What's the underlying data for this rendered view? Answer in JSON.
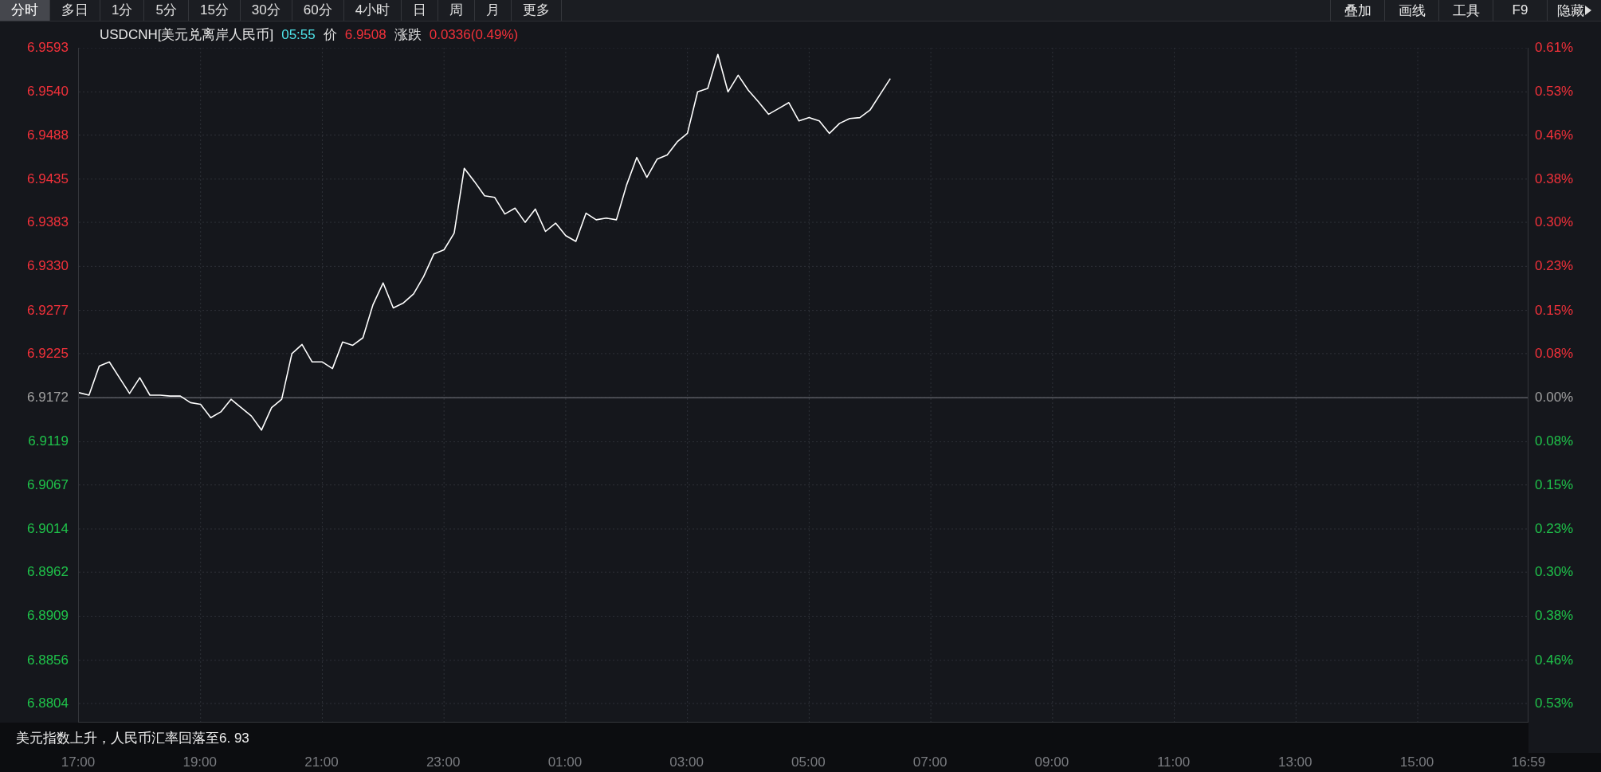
{
  "toolbar": {
    "tabs": [
      {
        "label": "分时",
        "selected": true
      },
      {
        "label": "多日",
        "selected": false
      },
      {
        "label": "1分",
        "selected": false
      },
      {
        "label": "5分",
        "selected": false
      },
      {
        "label": "15分",
        "selected": false
      },
      {
        "label": "30分",
        "selected": false
      },
      {
        "label": "60分",
        "selected": false
      },
      {
        "label": "4小时",
        "selected": false
      },
      {
        "label": "日",
        "selected": false
      },
      {
        "label": "周",
        "selected": false
      },
      {
        "label": "月",
        "selected": false
      },
      {
        "label": "更多",
        "selected": false
      }
    ],
    "tools": [
      {
        "label": "叠加",
        "kind": "button"
      },
      {
        "label": "画线",
        "kind": "button"
      },
      {
        "label": "工具",
        "kind": "button"
      },
      {
        "label": "F9",
        "kind": "button"
      },
      {
        "label": "隐藏",
        "kind": "expander"
      }
    ]
  },
  "quote": {
    "symbol": "USDCNH[美元兑离岸人民币]",
    "time": "05:55",
    "price_label": "价",
    "price": "6.9508",
    "change_label": "涨跌",
    "change": "0.0336(0.49%)"
  },
  "chart": {
    "percent_labels": [
      "0.61%",
      "0.53%",
      "0.46%",
      "0.38%",
      "0.30%",
      "0.23%",
      "0.15%",
      "0.08%",
      "0.00%",
      "0.08%",
      "0.15%",
      "0.23%",
      "0.30%",
      "0.38%",
      "0.46%",
      "0.53%"
    ],
    "chart_data": {
      "type": "line",
      "grid": true,
      "ylim": [
        6.8781,
        6.9593
      ],
      "categories": [
        "17:00",
        null,
        null,
        null,
        null,
        null,
        null,
        null,
        null,
        null,
        null,
        null,
        "19:00",
        null,
        null,
        null,
        null,
        null,
        null,
        null,
        null,
        null,
        null,
        null,
        "21:00",
        null,
        null,
        null,
        null,
        null,
        null,
        null,
        null,
        null,
        null,
        null,
        "23:00",
        null,
        null,
        null,
        null,
        null,
        null,
        null,
        null,
        null,
        null,
        null,
        "01:00",
        null,
        null,
        null,
        null,
        null,
        null,
        null,
        null,
        null,
        null,
        null,
        "03:00",
        null,
        null,
        null,
        null,
        null,
        null,
        null,
        null,
        null,
        null,
        null,
        "05:00",
        null,
        null,
        null,
        null,
        null,
        null,
        null,
        null,
        null,
        null,
        null,
        "07:00",
        null,
        null,
        null,
        null,
        null,
        null,
        null,
        null,
        null,
        null,
        null,
        "09:00",
        null,
        null,
        null,
        null,
        null,
        null,
        null,
        null,
        null,
        null,
        null,
        "11:00",
        null,
        null,
        null,
        null,
        null,
        null,
        null,
        null,
        null,
        null,
        null,
        "13:00",
        null,
        null,
        null,
        null,
        null,
        null,
        null,
        null,
        null,
        null,
        null,
        "15:00",
        null,
        null,
        null,
        null,
        null,
        null,
        null,
        null,
        null,
        null,
        "16:59"
      ],
      "yticks": [
        {
          "value": 6.9593,
          "label": "6.9593"
        },
        {
          "value": 6.954,
          "label": "6.9540"
        },
        {
          "value": 6.9488,
          "label": "6.9488"
        },
        {
          "value": 6.9435,
          "label": "6.9435"
        },
        {
          "value": 6.9383,
          "label": "6.9383"
        },
        {
          "value": 6.933,
          "label": "6.9330"
        },
        {
          "value": 6.9277,
          "label": "6.9277"
        },
        {
          "value": 6.9225,
          "label": "6.9225"
        },
        {
          "value": 6.9172,
          "label": "6.9172"
        },
        {
          "value": 6.9119,
          "label": "6.9119"
        },
        {
          "value": 6.9067,
          "label": "6.9067"
        },
        {
          "value": 6.9014,
          "label": "6.9014"
        },
        {
          "value": 6.8962,
          "label": "6.8962"
        },
        {
          "value": 6.8909,
          "label": "6.8909"
        },
        {
          "value": 6.8856,
          "label": "6.8856"
        },
        {
          "value": 6.8804,
          "label": "6.8804"
        }
      ],
      "ref_lines": [
        {
          "axis": "y",
          "value": 6.9172
        }
      ],
      "series": [
        {
          "color": "#ffffff",
          "values": [
            6.9178,
            6.9175,
            6.921,
            6.9215,
            6.9196,
            6.9177,
            6.9196,
            6.9175,
            6.9175,
            6.9174,
            6.9174,
            6.9166,
            6.9164,
            6.9148,
            6.9155,
            6.917,
            6.916,
            6.915,
            6.9133,
            6.916,
            6.917,
            6.9225,
            6.9236,
            6.9215,
            6.9215,
            6.9207,
            6.9239,
            6.9235,
            6.9244,
            6.9284,
            6.931,
            6.928,
            6.9286,
            6.9297,
            6.9318,
            6.9345,
            6.935,
            6.937,
            6.9448,
            6.9432,
            6.9415,
            6.9413,
            6.9393,
            6.94,
            6.9383,
            6.9399,
            6.9372,
            6.9382,
            6.9367,
            6.936,
            6.9394,
            6.9386,
            6.9388,
            6.9386,
            6.9428,
            6.9461,
            6.9437,
            6.9459,
            6.9464,
            6.948,
            6.949,
            6.954,
            6.9544,
            6.9585,
            6.954,
            6.956,
            6.9542,
            6.9528,
            6.9513,
            6.952,
            6.9527,
            6.9505,
            6.9509,
            6.9505,
            6.949,
            6.9502,
            6.9508,
            6.9509,
            6.9518,
            6.9537,
            6.9556,
            null,
            null,
            null,
            null,
            null,
            null,
            null,
            null,
            null,
            null,
            null,
            null,
            null,
            null,
            null,
            null,
            null,
            null,
            null,
            null,
            null,
            null,
            null,
            null,
            null,
            null,
            null,
            null,
            null,
            null,
            null,
            null,
            null,
            null,
            null,
            null,
            null,
            null,
            null,
            null,
            null,
            null,
            null,
            null,
            null,
            null,
            null,
            null,
            null,
            null,
            null,
            null,
            null,
            null,
            null,
            null,
            null,
            null,
            null,
            null,
            null,
            null,
            null
          ]
        }
      ]
    }
  },
  "news": {
    "headline": "美元指数上升，人民币汇率回落至6. 93"
  }
}
